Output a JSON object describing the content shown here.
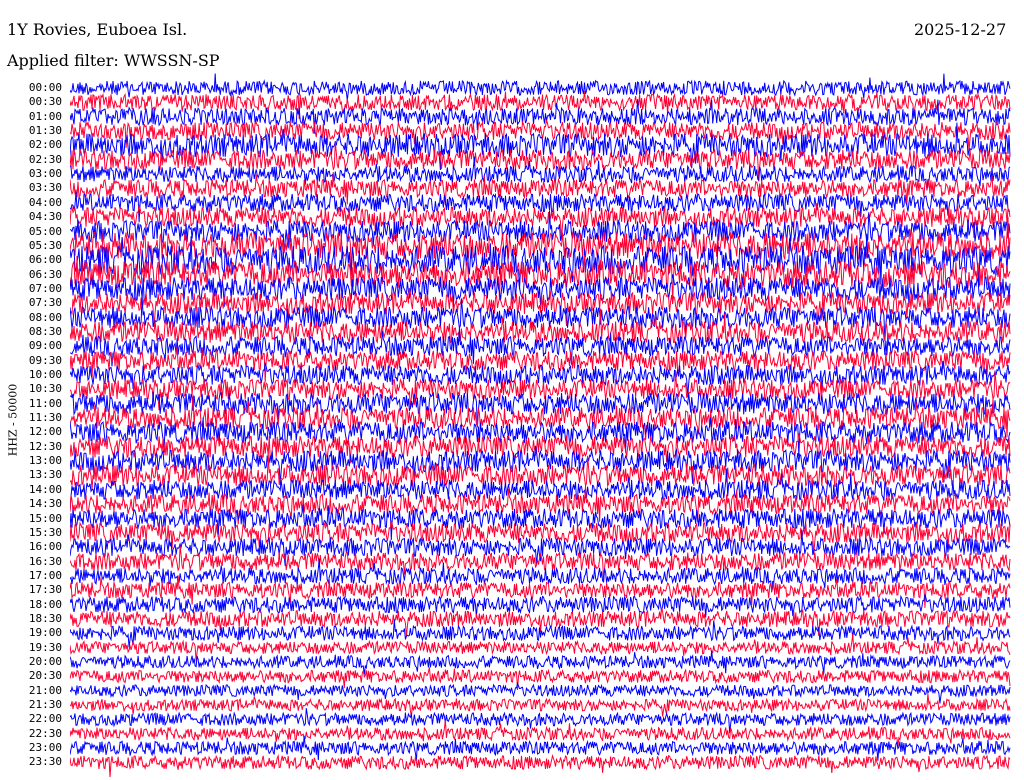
{
  "header": {
    "station": "1Y Rovies, Euboea Isl.",
    "date": "2025-12-27",
    "filter": "Applied filter: WWSSN-SP"
  },
  "chart_data": {
    "type": "line",
    "title": "1Y Rovies, Euboea Isl.",
    "subtitle": "Applied filter: WWSSN-SP",
    "ylabel": "HHZ - 50000",
    "row_labels": [
      "00:00",
      "00:30",
      "01:00",
      "01:30",
      "02:00",
      "02:30",
      "03:00",
      "03:30",
      "04:00",
      "04:30",
      "05:00",
      "05:30",
      "06:00",
      "06:30",
      "07:00",
      "07:30",
      "08:00",
      "08:30",
      "09:00",
      "09:30",
      "10:00",
      "10:30",
      "11:00",
      "11:30",
      "12:00",
      "12:30",
      "13:00",
      "13:30",
      "14:00",
      "14:30",
      "15:00",
      "15:30",
      "16:00",
      "16:30",
      "17:00",
      "17:30",
      "18:00",
      "18:30",
      "19:00",
      "19:30",
      "20:00",
      "20:30",
      "21:00",
      "21:30",
      "22:00",
      "22:30",
      "23:00",
      "23:30"
    ],
    "series_colors": [
      "#0000ff",
      "#ff0033"
    ],
    "row_amplitude": [
      0.8,
      0.9,
      0.95,
      1.0,
      1.3,
      1.1,
      0.9,
      1.0,
      1.0,
      1.1,
      1.2,
      1.5,
      1.6,
      1.5,
      1.3,
      1.2,
      1.2,
      1.2,
      1.1,
      1.1,
      1.1,
      1.1,
      1.2,
      1.2,
      1.2,
      1.2,
      1.2,
      1.2,
      1.1,
      1.1,
      1.1,
      1.1,
      1.0,
      1.0,
      0.9,
      0.9,
      0.9,
      0.9,
      0.8,
      0.7,
      0.7,
      0.7,
      0.65,
      0.65,
      0.7,
      0.7,
      0.75,
      0.75
    ],
    "samples_per_row": 940,
    "grid": false
  }
}
